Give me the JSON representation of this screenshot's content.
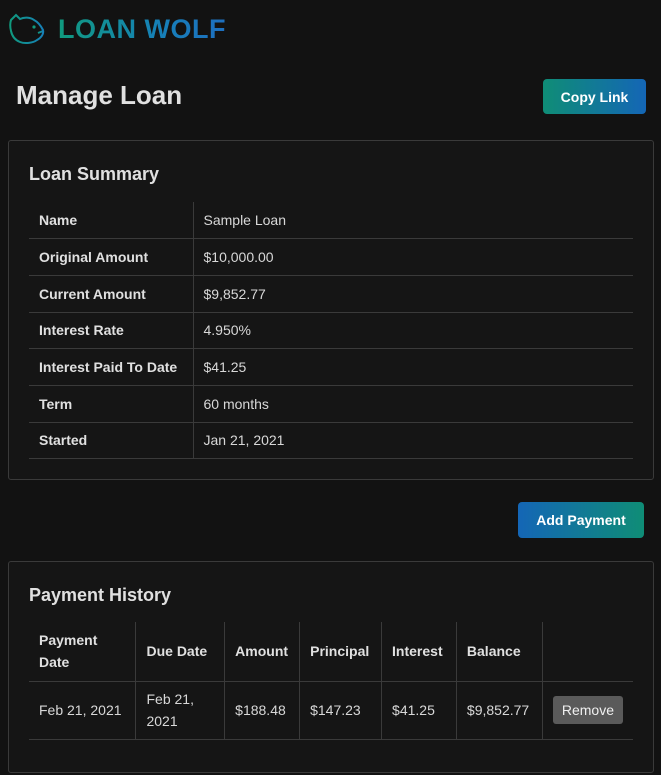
{
  "app": {
    "name": "LOAN WOLF",
    "logo_icon": "wolf-head-icon",
    "accent_start": "#109a7e",
    "accent_end": "#1e6fbf"
  },
  "page": {
    "title": "Manage Loan",
    "copy_link_label": "Copy Link"
  },
  "summary": {
    "title": "Loan Summary",
    "rows": [
      {
        "label": "Name",
        "value": "Sample Loan"
      },
      {
        "label": "Original Amount",
        "value": "$10,000.00"
      },
      {
        "label": "Current Amount",
        "value": "$9,852.77"
      },
      {
        "label": "Interest Rate",
        "value": "4.950%"
      },
      {
        "label": "Interest Paid To Date",
        "value": "$41.25"
      },
      {
        "label": "Term",
        "value": "60 months"
      },
      {
        "label": "Started",
        "value": "Jan 21, 2021"
      }
    ]
  },
  "actions": {
    "add_payment_label": "Add Payment"
  },
  "history": {
    "title": "Payment History",
    "columns": [
      "Payment Date",
      "Due Date",
      "Amount",
      "Principal",
      "Interest",
      "Balance"
    ],
    "rows": [
      {
        "payment_date": "Feb 21, 2021",
        "due_date": "Feb 21, 2021",
        "amount": "$188.48",
        "principal": "$147.23",
        "interest": "$41.25",
        "balance": "$9,852.77",
        "remove_label": "Remove"
      }
    ]
  }
}
